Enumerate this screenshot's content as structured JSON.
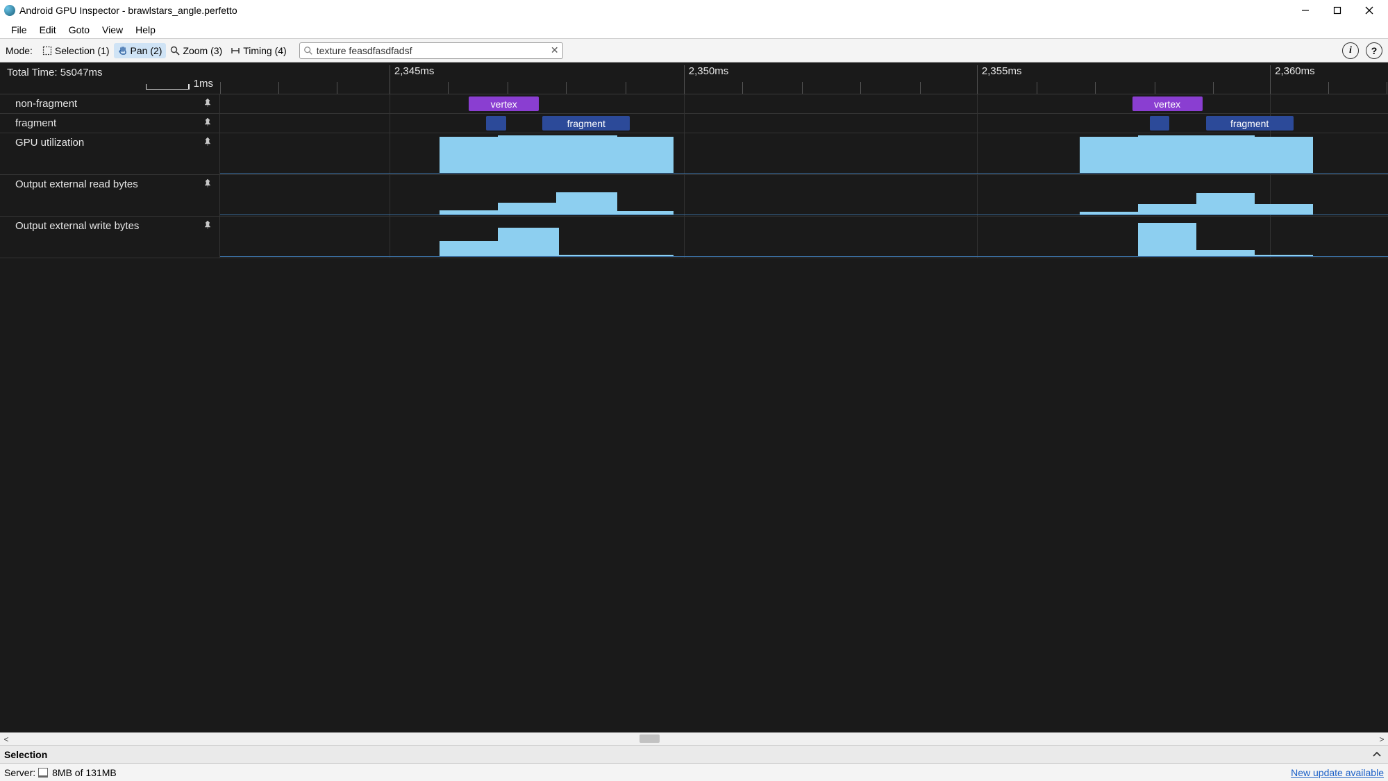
{
  "window": {
    "title": "Android GPU Inspector - brawlstars_angle.perfetto"
  },
  "menus": [
    "File",
    "Edit",
    "Goto",
    "View",
    "Help"
  ],
  "toolbar": {
    "mode_label": "Mode:",
    "modes": [
      {
        "id": "selection",
        "label": "Selection (1)"
      },
      {
        "id": "pan",
        "label": "Pan (2)"
      },
      {
        "id": "zoom",
        "label": "Zoom (3)"
      },
      {
        "id": "timing",
        "label": "Timing (4)"
      }
    ],
    "active_mode": "pan",
    "search_value": "texture feasdfasdfadsf",
    "info_label": "i",
    "help_label": "?"
  },
  "timeline": {
    "total_time_label": "Total Time: 5s047ms",
    "scale_label": "1ms",
    "tick_labels": [
      {
        "text": "2,345ms",
        "pct": 14.5
      },
      {
        "text": "2,350ms",
        "pct": 39.7
      },
      {
        "text": "2,355ms",
        "pct": 64.8
      },
      {
        "text": "2,360ms",
        "pct": 89.9
      }
    ],
    "minor_tick_pcts": [
      0,
      5,
      10,
      14.5,
      19.5,
      24.6,
      29.6,
      34.7,
      39.7,
      44.7,
      49.8,
      54.8,
      59.9,
      64.8,
      69.9,
      74.9,
      80.0,
      85.0,
      89.9,
      94.9,
      99.9
    ],
    "vgrid_pcts": [
      14.5,
      39.7,
      64.8,
      89.9
    ],
    "tracks": [
      {
        "name": "non-fragment",
        "type": "flame",
        "spans": [
          {
            "label": "vertex",
            "left_pct": 21.3,
            "width_pct": 6.0,
            "color": "purple"
          },
          {
            "label": "vertex",
            "left_pct": 78.1,
            "width_pct": 6.0,
            "color": "purple"
          }
        ]
      },
      {
        "name": "fragment",
        "type": "flame",
        "spans": [
          {
            "label": "",
            "left_pct": 22.8,
            "width_pct": 1.7,
            "color": "blue"
          },
          {
            "label": "fragment",
            "left_pct": 27.6,
            "width_pct": 7.5,
            "color": "blue"
          },
          {
            "label": "",
            "left_pct": 79.6,
            "width_pct": 1.7,
            "color": "blue"
          },
          {
            "label": "fragment",
            "left_pct": 84.4,
            "width_pct": 7.5,
            "color": "blue"
          }
        ]
      },
      {
        "name": "GPU utilization",
        "type": "counter",
        "steps": [
          {
            "left_pct": 18.8,
            "width_pct": 5.0,
            "h_pct": 88
          },
          {
            "left_pct": 23.8,
            "width_pct": 5.0,
            "h_pct": 92
          },
          {
            "left_pct": 28.8,
            "width_pct": 5.2,
            "h_pct": 92
          },
          {
            "left_pct": 34.0,
            "width_pct": 4.8,
            "h_pct": 88
          },
          {
            "left_pct": 73.6,
            "width_pct": 5.0,
            "h_pct": 88
          },
          {
            "left_pct": 78.6,
            "width_pct": 5.0,
            "h_pct": 92
          },
          {
            "left_pct": 83.6,
            "width_pct": 5.0,
            "h_pct": 92
          },
          {
            "left_pct": 88.6,
            "width_pct": 5.0,
            "h_pct": 88
          }
        ]
      },
      {
        "name": "Output external read bytes",
        "type": "counter",
        "steps": [
          {
            "left_pct": 18.8,
            "width_pct": 5.0,
            "h_pct": 10
          },
          {
            "left_pct": 23.8,
            "width_pct": 5.0,
            "h_pct": 28
          },
          {
            "left_pct": 28.8,
            "width_pct": 5.2,
            "h_pct": 55
          },
          {
            "left_pct": 34.0,
            "width_pct": 4.8,
            "h_pct": 8
          },
          {
            "left_pct": 73.6,
            "width_pct": 5.0,
            "h_pct": 6
          },
          {
            "left_pct": 78.6,
            "width_pct": 5.0,
            "h_pct": 25
          },
          {
            "left_pct": 83.6,
            "width_pct": 5.0,
            "h_pct": 52
          },
          {
            "left_pct": 88.6,
            "width_pct": 5.0,
            "h_pct": 25
          }
        ]
      },
      {
        "name": "Output external write bytes",
        "type": "counter",
        "steps": [
          {
            "left_pct": 18.8,
            "width_pct": 5.0,
            "h_pct": 38
          },
          {
            "left_pct": 23.8,
            "width_pct": 5.2,
            "h_pct": 70
          },
          {
            "left_pct": 29.0,
            "width_pct": 4.8,
            "h_pct": 4
          },
          {
            "left_pct": 33.8,
            "width_pct": 5.0,
            "h_pct": 3
          },
          {
            "left_pct": 78.6,
            "width_pct": 5.0,
            "h_pct": 82
          },
          {
            "left_pct": 83.6,
            "width_pct": 5.0,
            "h_pct": 15
          },
          {
            "left_pct": 88.6,
            "width_pct": 5.0,
            "h_pct": 3
          }
        ]
      }
    ]
  },
  "hscroll": {
    "thumb_left_pct": 46,
    "thumb_width_pct": 1.5
  },
  "selection_panel": {
    "title": "Selection"
  },
  "statusbar": {
    "server_label": "Server:",
    "memory": "8MB of 131MB",
    "update_link": "New update available"
  }
}
